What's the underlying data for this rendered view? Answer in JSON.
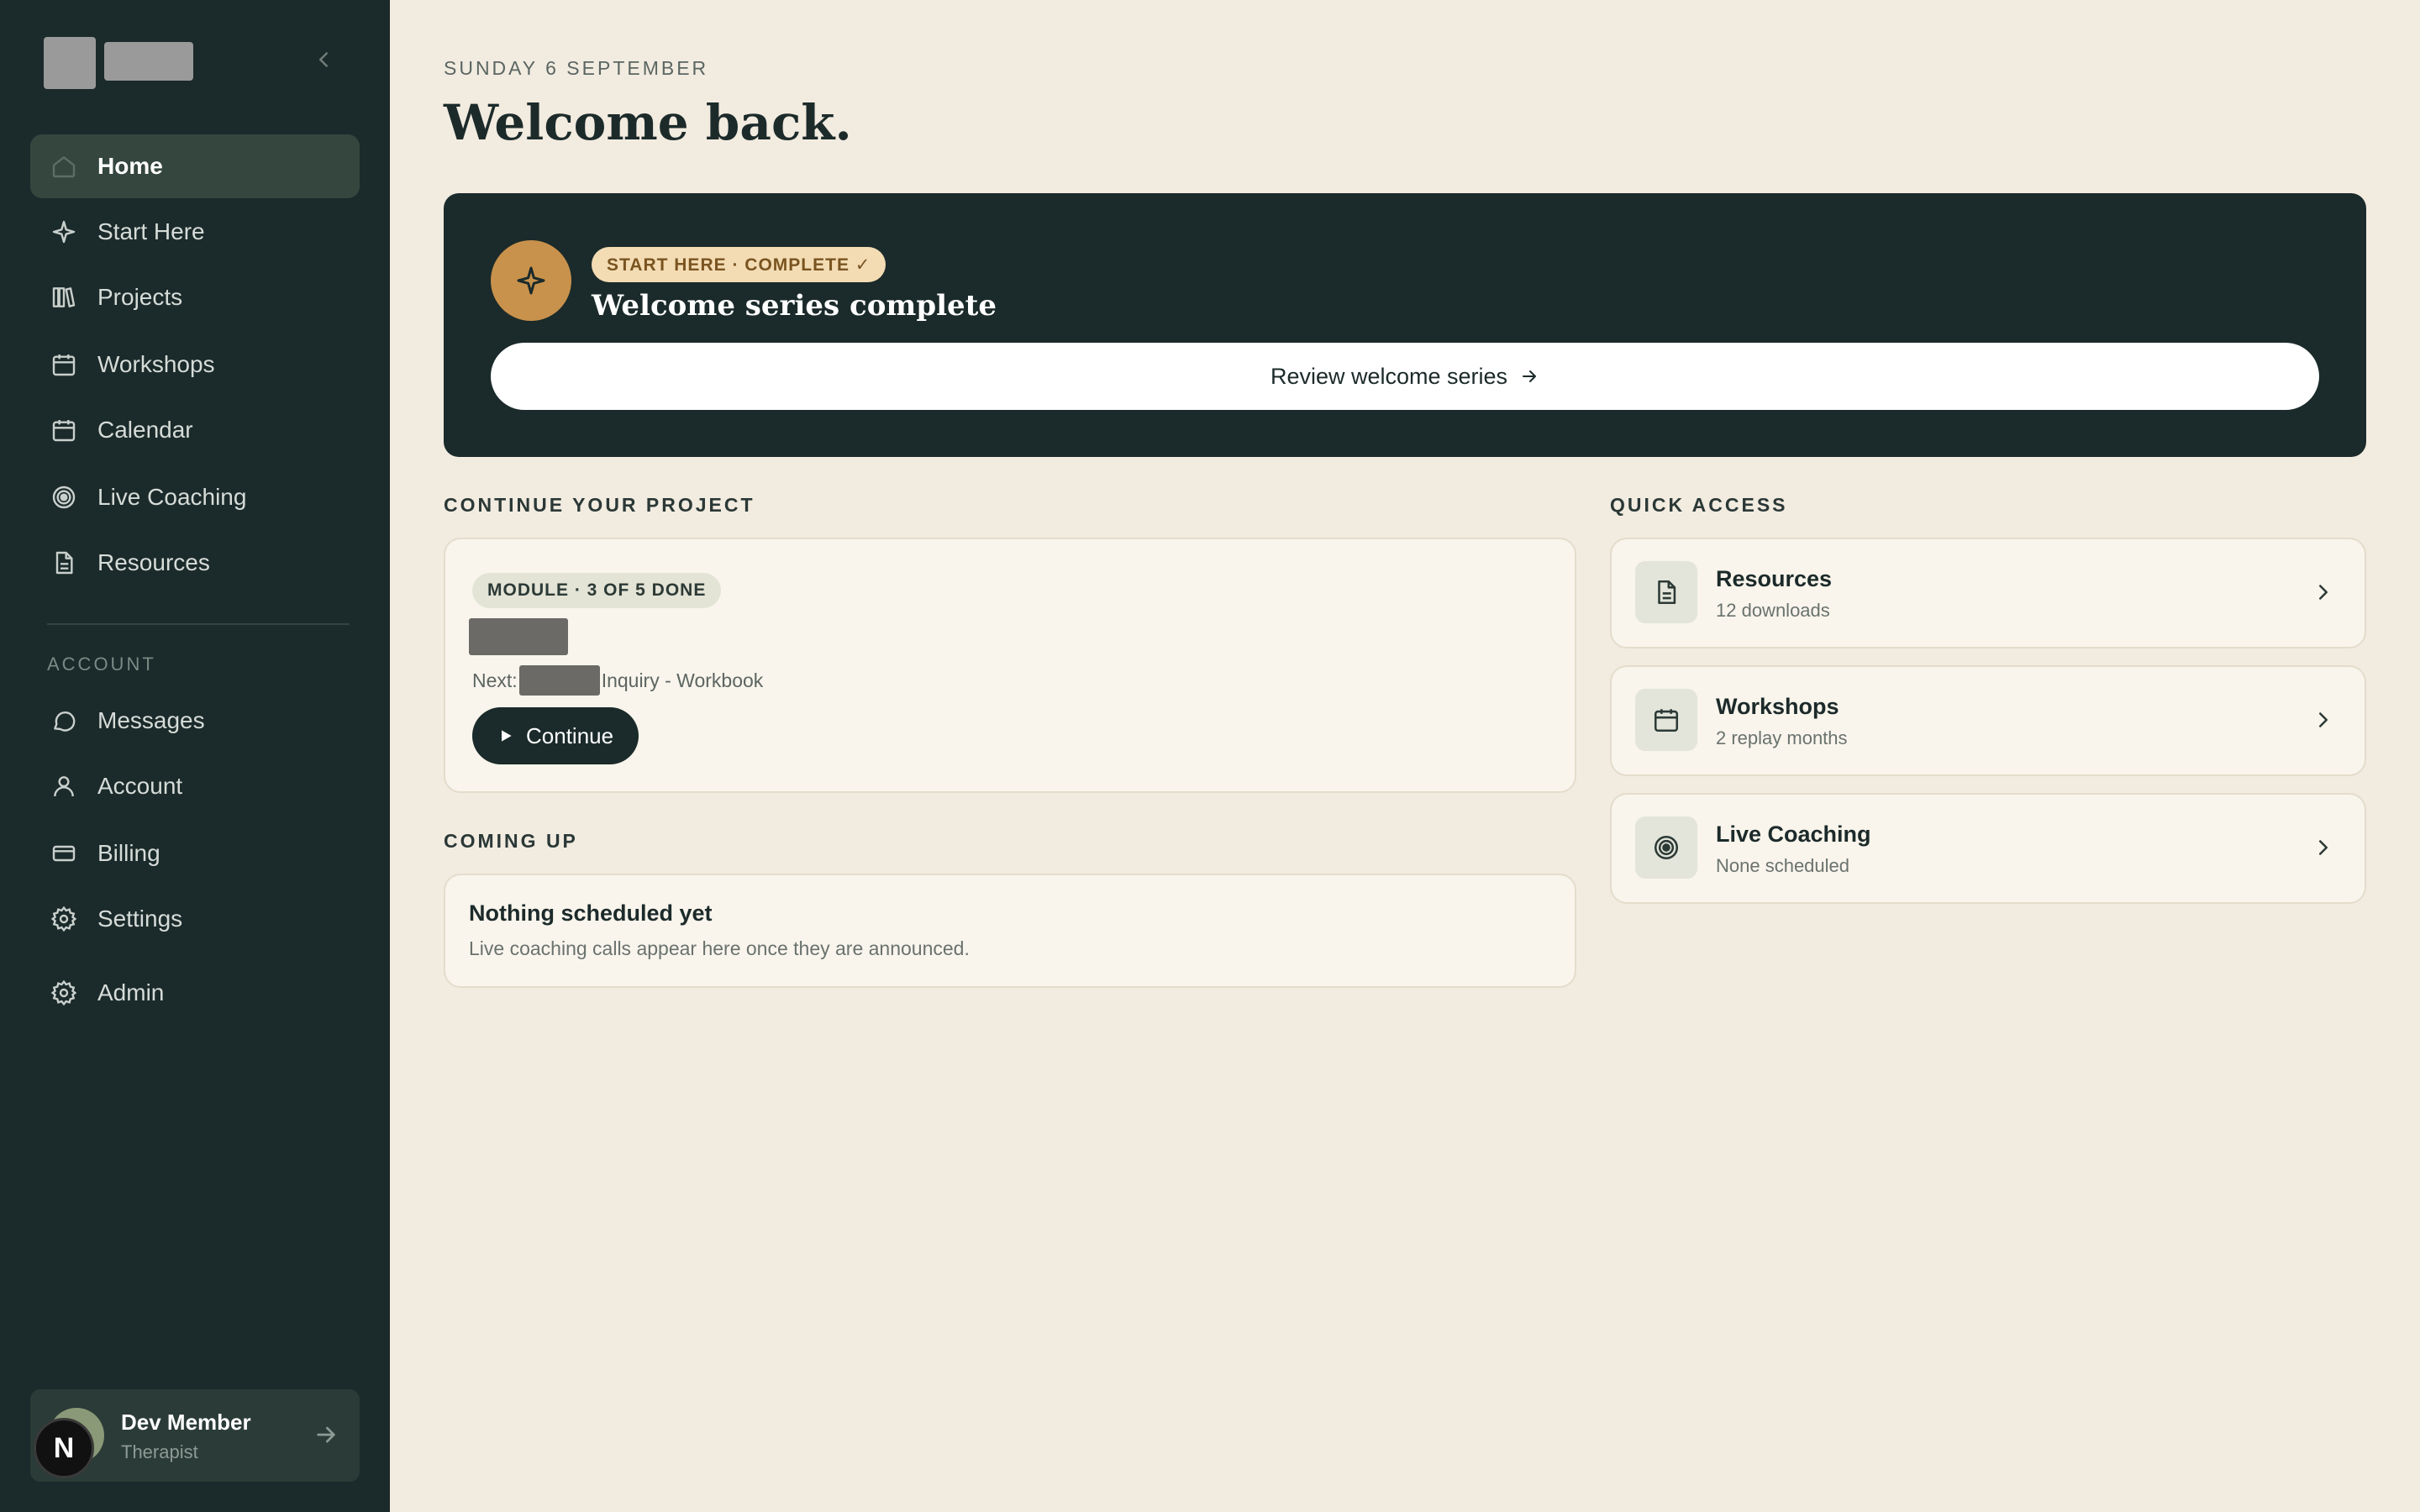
{
  "sidebar": {
    "nav": [
      {
        "label": "Home",
        "icon": "home-icon",
        "active": true
      },
      {
        "label": "Start Here",
        "icon": "sparkle-icon"
      },
      {
        "label": "Projects",
        "icon": "books-icon"
      },
      {
        "label": "Workshops",
        "icon": "calendar-icon"
      },
      {
        "label": "Calendar",
        "icon": "calendar-icon"
      },
      {
        "label": "Live Coaching",
        "icon": "target-icon"
      },
      {
        "label": "Resources",
        "icon": "document-icon"
      }
    ],
    "account_label": "ACCOUNT",
    "account": [
      {
        "label": "Messages",
        "icon": "chat-icon"
      },
      {
        "label": "Account",
        "icon": "user-icon"
      },
      {
        "label": "Billing",
        "icon": "credit-card-icon"
      },
      {
        "label": "Settings",
        "icon": "gear-icon"
      },
      {
        "label": "Admin",
        "icon": "gear-icon"
      }
    ],
    "user": {
      "initial": "N",
      "name": "Dev Member",
      "role": "Therapist"
    }
  },
  "main": {
    "date": "SUNDAY 6 SEPTEMBER",
    "title": "Welcome back.",
    "hero": {
      "badge": "START HERE · COMPLETE ✓",
      "title": "Welcome series complete",
      "button": "Review welcome series"
    },
    "continue_project": {
      "heading": "CONTINUE YOUR PROJECT",
      "badge": "MODULE · 3 OF 5 DONE",
      "next_prefix": "Next:",
      "next_suffix": "Inquiry - Workbook",
      "button": "Continue"
    },
    "coming_up": {
      "heading": "COMING UP",
      "title": "Nothing scheduled yet",
      "subtitle": "Live coaching calls appear here once they are announced."
    },
    "quick_access": {
      "heading": "QUICK ACCESS",
      "items": [
        {
          "title": "Resources",
          "subtitle": "12 downloads",
          "icon": "document-icon"
        },
        {
          "title": "Workshops",
          "subtitle": "2 replay months",
          "icon": "calendar-icon"
        },
        {
          "title": "Live Coaching",
          "subtitle": "None scheduled",
          "icon": "target-icon"
        }
      ]
    }
  },
  "colors": {
    "sidebar_bg": "#1b2a2a",
    "page_bg": "#f2ebe0",
    "accent": "#c8924c",
    "card_bg": "#f9f5ec"
  }
}
